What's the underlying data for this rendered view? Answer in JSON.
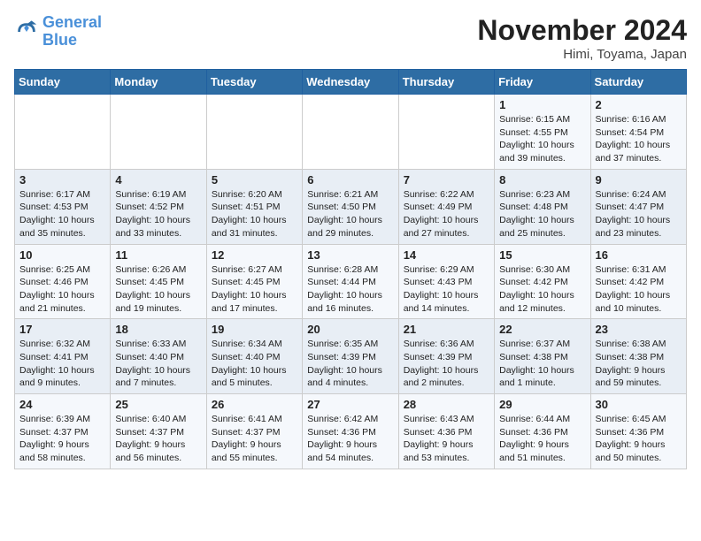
{
  "logo": {
    "line1": "General",
    "line2": "Blue"
  },
  "title": "November 2024",
  "location": "Himi, Toyama, Japan",
  "weekdays": [
    "Sunday",
    "Monday",
    "Tuesday",
    "Wednesday",
    "Thursday",
    "Friday",
    "Saturday"
  ],
  "weeks": [
    [
      {
        "day": "",
        "info": ""
      },
      {
        "day": "",
        "info": ""
      },
      {
        "day": "",
        "info": ""
      },
      {
        "day": "",
        "info": ""
      },
      {
        "day": "",
        "info": ""
      },
      {
        "day": "1",
        "info": "Sunrise: 6:15 AM\nSunset: 4:55 PM\nDaylight: 10 hours\nand 39 minutes."
      },
      {
        "day": "2",
        "info": "Sunrise: 6:16 AM\nSunset: 4:54 PM\nDaylight: 10 hours\nand 37 minutes."
      }
    ],
    [
      {
        "day": "3",
        "info": "Sunrise: 6:17 AM\nSunset: 4:53 PM\nDaylight: 10 hours\nand 35 minutes."
      },
      {
        "day": "4",
        "info": "Sunrise: 6:19 AM\nSunset: 4:52 PM\nDaylight: 10 hours\nand 33 minutes."
      },
      {
        "day": "5",
        "info": "Sunrise: 6:20 AM\nSunset: 4:51 PM\nDaylight: 10 hours\nand 31 minutes."
      },
      {
        "day": "6",
        "info": "Sunrise: 6:21 AM\nSunset: 4:50 PM\nDaylight: 10 hours\nand 29 minutes."
      },
      {
        "day": "7",
        "info": "Sunrise: 6:22 AM\nSunset: 4:49 PM\nDaylight: 10 hours\nand 27 minutes."
      },
      {
        "day": "8",
        "info": "Sunrise: 6:23 AM\nSunset: 4:48 PM\nDaylight: 10 hours\nand 25 minutes."
      },
      {
        "day": "9",
        "info": "Sunrise: 6:24 AM\nSunset: 4:47 PM\nDaylight: 10 hours\nand 23 minutes."
      }
    ],
    [
      {
        "day": "10",
        "info": "Sunrise: 6:25 AM\nSunset: 4:46 PM\nDaylight: 10 hours\nand 21 minutes."
      },
      {
        "day": "11",
        "info": "Sunrise: 6:26 AM\nSunset: 4:45 PM\nDaylight: 10 hours\nand 19 minutes."
      },
      {
        "day": "12",
        "info": "Sunrise: 6:27 AM\nSunset: 4:45 PM\nDaylight: 10 hours\nand 17 minutes."
      },
      {
        "day": "13",
        "info": "Sunrise: 6:28 AM\nSunset: 4:44 PM\nDaylight: 10 hours\nand 16 minutes."
      },
      {
        "day": "14",
        "info": "Sunrise: 6:29 AM\nSunset: 4:43 PM\nDaylight: 10 hours\nand 14 minutes."
      },
      {
        "day": "15",
        "info": "Sunrise: 6:30 AM\nSunset: 4:42 PM\nDaylight: 10 hours\nand 12 minutes."
      },
      {
        "day": "16",
        "info": "Sunrise: 6:31 AM\nSunset: 4:42 PM\nDaylight: 10 hours\nand 10 minutes."
      }
    ],
    [
      {
        "day": "17",
        "info": "Sunrise: 6:32 AM\nSunset: 4:41 PM\nDaylight: 10 hours\nand 9 minutes."
      },
      {
        "day": "18",
        "info": "Sunrise: 6:33 AM\nSunset: 4:40 PM\nDaylight: 10 hours\nand 7 minutes."
      },
      {
        "day": "19",
        "info": "Sunrise: 6:34 AM\nSunset: 4:40 PM\nDaylight: 10 hours\nand 5 minutes."
      },
      {
        "day": "20",
        "info": "Sunrise: 6:35 AM\nSunset: 4:39 PM\nDaylight: 10 hours\nand 4 minutes."
      },
      {
        "day": "21",
        "info": "Sunrise: 6:36 AM\nSunset: 4:39 PM\nDaylight: 10 hours\nand 2 minutes."
      },
      {
        "day": "22",
        "info": "Sunrise: 6:37 AM\nSunset: 4:38 PM\nDaylight: 10 hours\nand 1 minute."
      },
      {
        "day": "23",
        "info": "Sunrise: 6:38 AM\nSunset: 4:38 PM\nDaylight: 9 hours\nand 59 minutes."
      }
    ],
    [
      {
        "day": "24",
        "info": "Sunrise: 6:39 AM\nSunset: 4:37 PM\nDaylight: 9 hours\nand 58 minutes."
      },
      {
        "day": "25",
        "info": "Sunrise: 6:40 AM\nSunset: 4:37 PM\nDaylight: 9 hours\nand 56 minutes."
      },
      {
        "day": "26",
        "info": "Sunrise: 6:41 AM\nSunset: 4:37 PM\nDaylight: 9 hours\nand 55 minutes."
      },
      {
        "day": "27",
        "info": "Sunrise: 6:42 AM\nSunset: 4:36 PM\nDaylight: 9 hours\nand 54 minutes."
      },
      {
        "day": "28",
        "info": "Sunrise: 6:43 AM\nSunset: 4:36 PM\nDaylight: 9 hours\nand 53 minutes."
      },
      {
        "day": "29",
        "info": "Sunrise: 6:44 AM\nSunset: 4:36 PM\nDaylight: 9 hours\nand 51 minutes."
      },
      {
        "day": "30",
        "info": "Sunrise: 6:45 AM\nSunset: 4:36 PM\nDaylight: 9 hours\nand 50 minutes."
      }
    ]
  ]
}
